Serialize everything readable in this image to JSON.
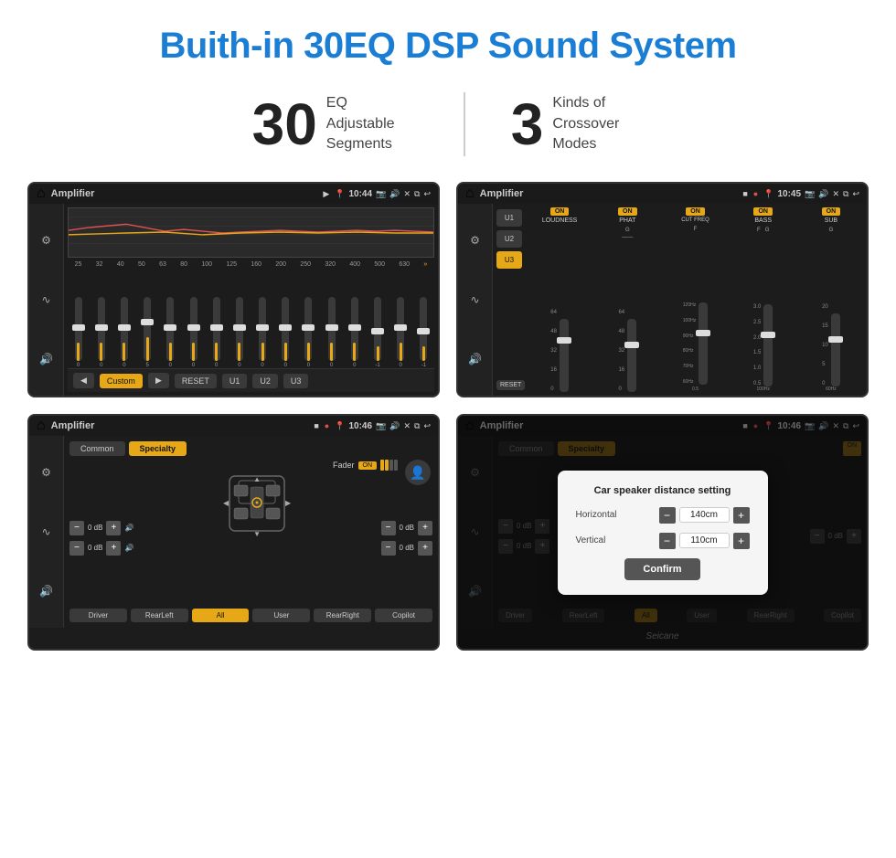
{
  "page": {
    "title": "Buith-in 30EQ DSP Sound System",
    "stats": {
      "eq_number": "30",
      "eq_label": "EQ Adjustable\nSegments",
      "crossover_number": "3",
      "crossover_label": "Kinds of\nCrossover Modes"
    },
    "watermark": "Seicane"
  },
  "screen_tl": {
    "app_name": "Amplifier",
    "time": "10:44",
    "eq_labels": [
      "25",
      "32",
      "40",
      "50",
      "63",
      "80",
      "100",
      "125",
      "160",
      "200",
      "250",
      "320",
      "400",
      "500",
      "630"
    ],
    "slider_values": [
      "0",
      "0",
      "0",
      "5",
      "0",
      "0",
      "0",
      "0",
      "0",
      "0",
      "0",
      "0",
      "0",
      "-1",
      "0",
      "-1"
    ],
    "custom_label": "Custom",
    "reset_label": "RESET",
    "presets": [
      "U1",
      "U2",
      "U3"
    ]
  },
  "screen_tr": {
    "app_name": "Amplifier",
    "time": "10:45",
    "presets": [
      "U1",
      "U2",
      "U3"
    ],
    "active_preset": "U3",
    "columns": [
      {
        "label": "LOUDNESS",
        "on": true
      },
      {
        "label": "PHAT",
        "on": true
      },
      {
        "label": "CUT FREQ",
        "on": true
      },
      {
        "label": "BASS",
        "on": true
      },
      {
        "label": "SUB",
        "on": true
      }
    ],
    "reset_label": "RESET"
  },
  "screen_bl": {
    "app_name": "Amplifier",
    "time": "10:46",
    "tabs": [
      "Common",
      "Specialty"
    ],
    "active_tab": "Specialty",
    "fader_label": "Fader",
    "on_label": "ON",
    "positions": [
      "Driver",
      "RearLeft",
      "All",
      "User",
      "RearRight",
      "Copilot"
    ],
    "active_position": "All",
    "vol_labels": [
      "0 dB",
      "0 dB",
      "0 dB",
      "0 dB"
    ]
  },
  "screen_br": {
    "app_name": "Amplifier",
    "time": "10:46",
    "tabs": [
      "Common",
      "Specialty"
    ],
    "dialog": {
      "title": "Car speaker distance setting",
      "horizontal_label": "Horizontal",
      "horizontal_value": "140cm",
      "vertical_label": "Vertical",
      "vertical_value": "110cm",
      "confirm_label": "Confirm"
    },
    "vol_labels": [
      "0 dB",
      "0 dB"
    ],
    "positions": [
      "Driver",
      "RearLeft",
      "All",
      "User",
      "RearRight",
      "Copilot"
    ]
  },
  "icons": {
    "home": "⌂",
    "play": "▶",
    "prev": "◀",
    "eq": "≡",
    "wave": "∿",
    "speaker": "🔊",
    "pin": "📍",
    "camera": "📷",
    "volume": "🔊",
    "close": "✕",
    "back": "↩",
    "settings": "⚙",
    "user": "👤"
  }
}
